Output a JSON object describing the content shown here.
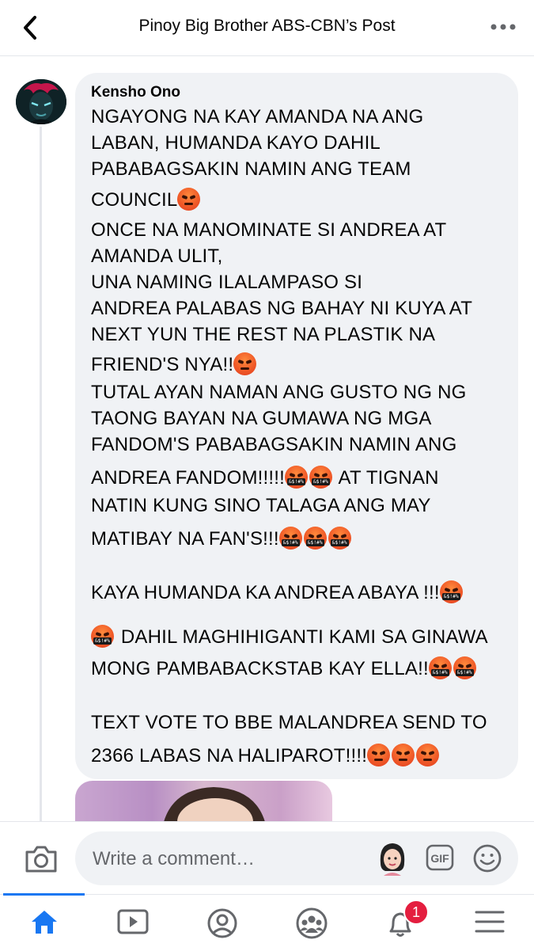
{
  "header": {
    "title": "Pinoy Big Brother ABS-CBN’s Post",
    "back_icon": "chevron-left-icon",
    "more_icon": "more-horizontal-icon"
  },
  "comment": {
    "author": "Kensho Ono",
    "lines": [
      {
        "text": "NGAYONG NA KAY AMANDA NA ANG",
        "emojis": []
      },
      {
        "text": "LABAN, HUMANDA KAYO DAHIL",
        "emojis": []
      },
      {
        "text": "PABABAGSAKIN NAMIN ANG TEAM",
        "emojis": []
      },
      {
        "text": "COUNCIL",
        "emojis": [
          "angry"
        ]
      },
      {
        "text": "ONCE NA MANOMINATE SI ANDREA AT",
        "emojis": []
      },
      {
        "text": "AMANDA ULIT,",
        "emojis": []
      },
      {
        "text": "UNA NAMING ILALAMPASO SI",
        "emojis": []
      },
      {
        "text": "ANDREA PALABAS NG BAHAY NI KUYA AT",
        "emojis": []
      },
      {
        "text": "NEXT YUN THE REST NA PLASTIK NA",
        "emojis": []
      },
      {
        "text": "FRIEND'S NYA!!",
        "emojis": [
          "angry"
        ]
      },
      {
        "text": "TUTAL AYAN NAMAN ANG GUSTO NG NG",
        "emojis": []
      },
      {
        "text": "TAONG BAYAN NA GUMAWA NG MGA",
        "emojis": []
      },
      {
        "text": "FANDOM'S PABABAGSAKIN NAMIN ANG",
        "emojis": []
      },
      {
        "text": "ANDREA FANDOM!!!!!",
        "emojis": [
          "curse",
          "curse"
        ],
        "after": " AT TIGNAN"
      },
      {
        "text": "NATIN KUNG SINO TALAGA ANG MAY",
        "emojis": []
      },
      {
        "text": "MATIBAY NA FAN'S!!!",
        "emojis": [
          "curse",
          "curse",
          "curse"
        ]
      },
      {
        "text": "KAYA HUMANDA KA ANDREA ABAYA !!!",
        "emojis": [
          "curse"
        ]
      },
      {
        "text": " DAHIL MAGHIHIGANTI KAMI SA GINAWA",
        "emojis_before": [
          "curse"
        ],
        "emojis": []
      },
      {
        "text": "MONG PAMBABACKSTAB KAY ELLA!!",
        "emojis": [
          "curse",
          "curse"
        ]
      },
      {
        "text": "TEXT VOTE TO BBE MALANDREA SEND TO",
        "emojis": []
      },
      {
        "text": "2366 LABAS NA HALIPAROT!!!!",
        "emojis": [
          "angry",
          "angry",
          "angry"
        ]
      }
    ]
  },
  "composer": {
    "placeholder": "Write a comment…",
    "camera_icon": "camera-icon",
    "avatar_icon": "avatar-sticker-icon",
    "gif_label": "GIF",
    "emoji_icon": "smile-icon"
  },
  "tabbar": {
    "tabs": [
      {
        "name": "home",
        "icon": "home-icon",
        "active": true
      },
      {
        "name": "watch",
        "icon": "video-icon"
      },
      {
        "name": "profile",
        "icon": "profile-icon"
      },
      {
        "name": "groups",
        "icon": "groups-icon"
      },
      {
        "name": "notifications",
        "icon": "bell-icon",
        "badge": "1"
      },
      {
        "name": "menu",
        "icon": "hamburger-icon"
      }
    ]
  },
  "colors": {
    "accent": "#1877f2",
    "bubble": "#f0f2f5",
    "badge": "#e41e3f"
  }
}
